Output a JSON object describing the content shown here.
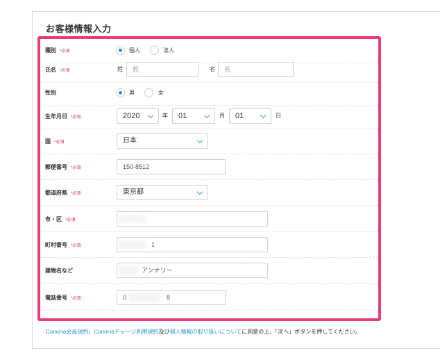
{
  "section_title": "お客様情報入力",
  "required_mark": "*必須",
  "fields": {
    "type": {
      "label": "種別",
      "options": [
        {
          "label": "個人",
          "selected": true
        },
        {
          "label": "法人",
          "selected": false
        }
      ]
    },
    "name": {
      "label": "氏名",
      "last_label": "姓",
      "last_placeholder": "姓",
      "first_label": "名",
      "first_placeholder": "名"
    },
    "gender": {
      "label": "性別",
      "options": [
        {
          "label": "男",
          "selected": true
        },
        {
          "label": "女",
          "selected": false
        }
      ]
    },
    "birth": {
      "label": "生年月日",
      "year": "2020",
      "year_unit": "年",
      "month": "01",
      "month_unit": "月",
      "day": "01",
      "day_unit": "日"
    },
    "country": {
      "label": "国",
      "value": "日本"
    },
    "postal": {
      "label": "郵便番号",
      "value": "150-8512"
    },
    "prefecture": {
      "label": "都道府県",
      "value": "東京都"
    },
    "city": {
      "label": "市・区",
      "value": ""
    },
    "town": {
      "label": "町村番号",
      "value": "1"
    },
    "building": {
      "label": "建物名など",
      "value": "アンナリー"
    },
    "phone": {
      "label": "電話番号",
      "value_start": "0",
      "value_end": "8"
    }
  },
  "footer": {
    "link1": "ConoHa会員規約",
    "sep1": "、",
    "link2": "ConoHaチャージ利用規約",
    "sep2": "及び",
    "link3": "個人情報の取り扱いについて",
    "text": "に同意の上、「次へ」ボタンを押してください。"
  },
  "colors": {
    "accent_frame": "#e83e75",
    "required": "#c8345f",
    "link": "#2a9ad6",
    "radio": "#2f8fd8"
  }
}
